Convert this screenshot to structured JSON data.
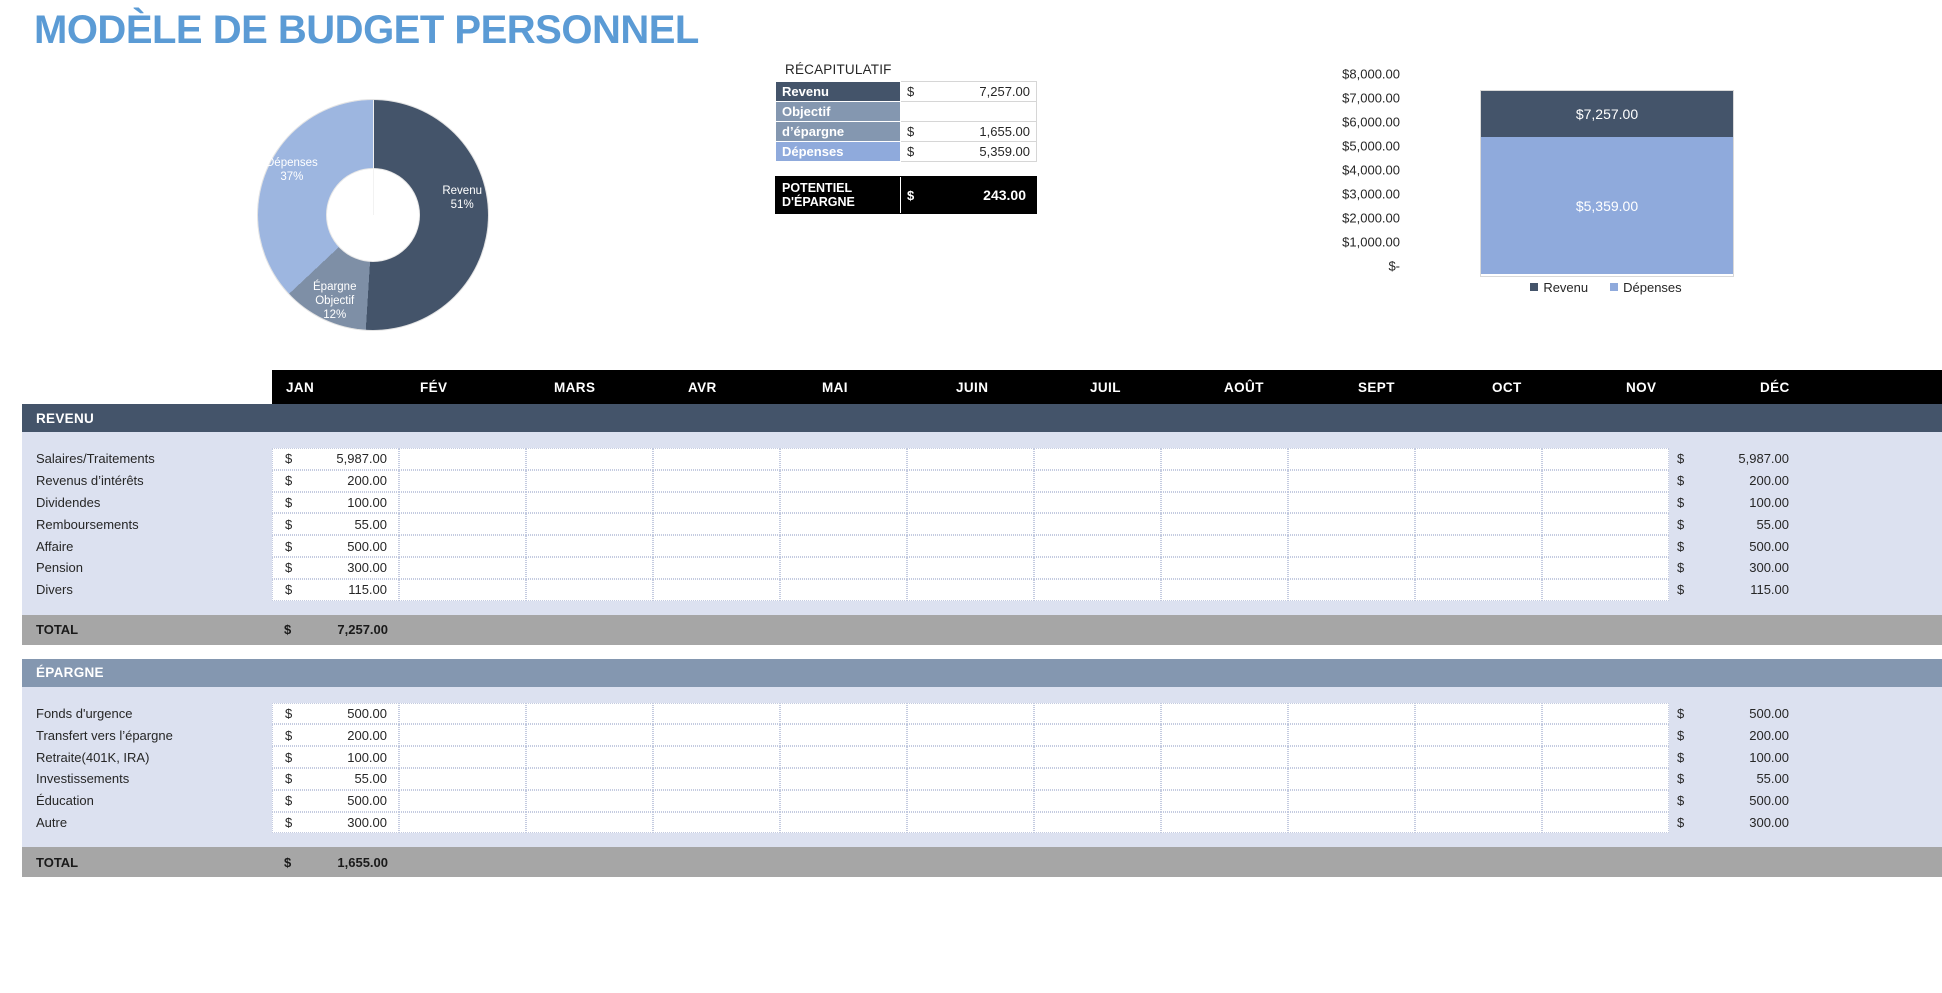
{
  "page": {
    "title": "MODÈLE DE BUDGET PERSONNEL"
  },
  "colors": {
    "title_blue": "#5B9BD5",
    "dark_slate": "#44546A",
    "mid_slate": "#8497B0",
    "light_blue": "#8FAADC",
    "donut_mid": "#7E8FA6",
    "row_bg": "#DCE1F0",
    "total_gray": "#A6A6A6",
    "header_black": "#000000"
  },
  "donut": {
    "name": "donut-chart",
    "slices": [
      {
        "label": "Revenu",
        "percent": "51%",
        "value": 51,
        "color": "#44546A"
      },
      {
        "label": "Dépenses",
        "percent": "37%",
        "value": 37,
        "color": "#9DB6E0"
      },
      {
        "label": "Épargne Objectif",
        "line1": "Épargne",
        "line2": "Objectif",
        "percent": "12%",
        "value": 12,
        "color": "#7E8FA6"
      }
    ]
  },
  "recap": {
    "title": "RÉCAPITULATIF",
    "rows": [
      {
        "label": "Revenu",
        "currency": "$",
        "value": "7,257.00",
        "swatch": "dark"
      },
      {
        "label": "Objectif d’épargne",
        "label_line1": "Objectif",
        "label_line2": "d’épargne",
        "currency": "$",
        "value": "1,655.00",
        "swatch": "mid"
      },
      {
        "label": "Dépenses",
        "currency": "$",
        "value": "5,359.00",
        "swatch": "light"
      }
    ],
    "potential": {
      "label_line1": "POTENTIEL",
      "label_line2": "D'ÉPARGNE",
      "currency": "$",
      "value": "243.00"
    }
  },
  "chart_data": [
    {
      "type": "pie",
      "title": "",
      "subtype": "donut",
      "labels": [
        "Revenu",
        "Dépenses",
        "Épargne Objectif"
      ],
      "values": [
        51,
        37,
        12
      ],
      "display_labels": [
        "Revenu 51%",
        "Dépenses 37%",
        "Épargne Objectif 12%"
      ],
      "colors": [
        "#44546A",
        "#9DB6E0",
        "#7E8FA6"
      ],
      "legend": "none"
    },
    {
      "type": "bar",
      "subtype": "stacked-column",
      "title": "",
      "categories": [
        ""
      ],
      "series": [
        {
          "name": "Revenu",
          "values": [
            7257.0
          ],
          "label": "$7,257.00",
          "color": "#44546A"
        },
        {
          "name": "Dépenses",
          "values": [
            5359.0
          ],
          "label": "$5,359.00",
          "color": "#8FAADC"
        }
      ],
      "ylim": [
        0,
        8000
      ],
      "ytick_labels": [
        "$8,000.00",
        "$7,000.00",
        "$6,000.00",
        "$5,000.00",
        "$4,000.00",
        "$3,000.00",
        "$2,000.00",
        "$1,000.00",
        "$-"
      ],
      "ytick_values": [
        8000,
        7000,
        6000,
        5000,
        4000,
        3000,
        2000,
        1000,
        0
      ],
      "xlabel": "",
      "ylabel": "",
      "grid": false,
      "legend": [
        "Revenu",
        "Dépenses"
      ],
      "legend_position": "bottom"
    }
  ],
  "months": [
    "JAN",
    "FÉV",
    "MARS",
    "AVR",
    "MAI",
    "JUIN",
    "JUIL",
    "AOÛT",
    "SEPT",
    "OCT",
    "NOV",
    "DÉC"
  ],
  "currency_symbol": "$",
  "sections": [
    {
      "id": "revenu",
      "band_label": "REVENU",
      "rows": [
        {
          "label": "Salaires/Traitements",
          "jan": "5,987.00",
          "total": "5,987.00"
        },
        {
          "label": "Revenus d’intérêts",
          "jan": "200.00",
          "total": "200.00"
        },
        {
          "label": "Dividendes",
          "jan": "100.00",
          "total": "100.00"
        },
        {
          "label": "Remboursements",
          "jan": "55.00",
          "total": "55.00"
        },
        {
          "label": "Affaire",
          "jan": "500.00",
          "total": "500.00"
        },
        {
          "label": "Pension",
          "jan": "300.00",
          "total": "300.00"
        },
        {
          "label": "Divers",
          "jan": "115.00",
          "total": "115.00"
        }
      ],
      "total": {
        "label": "TOTAL",
        "currency": "$",
        "value": "7,257.00"
      }
    },
    {
      "id": "epargne",
      "band_label": "ÉPARGNE",
      "rows": [
        {
          "label": "Fonds d'urgence",
          "jan": "500.00",
          "total": "500.00"
        },
        {
          "label": "Transfert vers l’épargne",
          "jan": "200.00",
          "total": "200.00"
        },
        {
          "label": "Retraite(401K, IRA)",
          "jan": "100.00",
          "total": "100.00"
        },
        {
          "label": "Investissements",
          "jan": "55.00",
          "total": "55.00"
        },
        {
          "label": "Éducation",
          "jan": "500.00",
          "total": "500.00"
        },
        {
          "label": "Autre",
          "jan": "300.00",
          "total": "300.00"
        }
      ],
      "total": {
        "label": "TOTAL",
        "currency": "$",
        "value": "1,655.00"
      }
    }
  ]
}
